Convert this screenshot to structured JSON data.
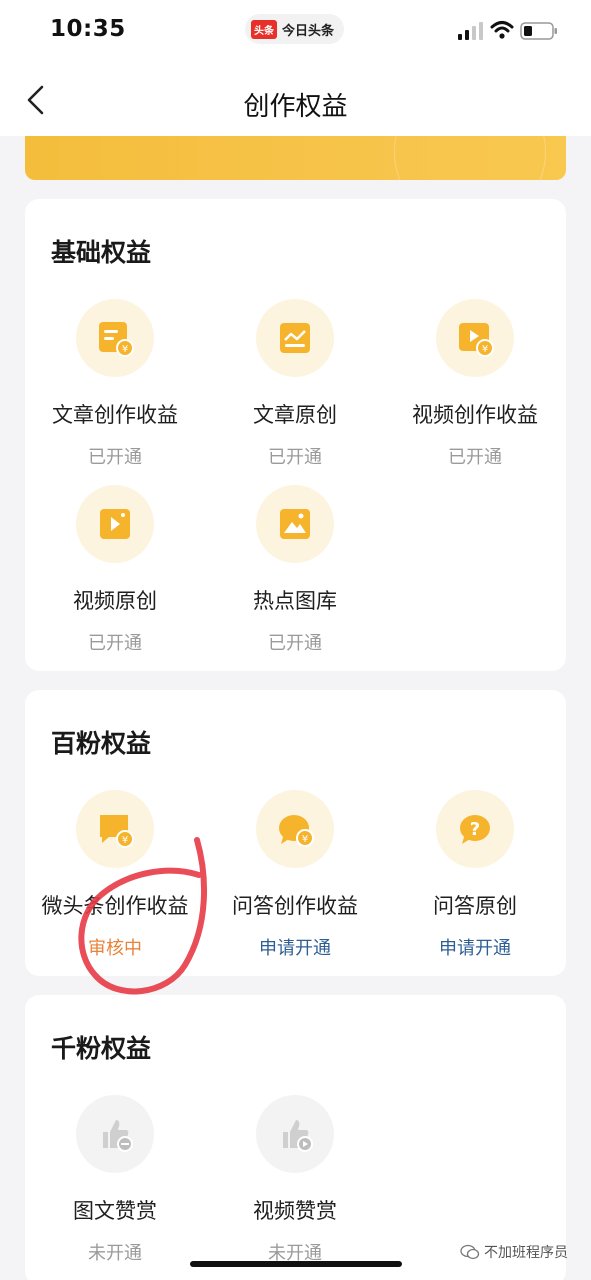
{
  "status_bar": {
    "time": "10:35",
    "app_logo": "头条",
    "app_name": "今日头条"
  },
  "nav": {
    "title": "创作权益"
  },
  "colors": {
    "accent": "#f5b731",
    "icon_bg": "#fdf4df",
    "status_orange": "#e8843a",
    "status_blue": "#2d5e94",
    "annotation_red": "#e63a46"
  },
  "sections": [
    {
      "title": "基础权益",
      "items": [
        {
          "label": "文章创作收益",
          "status": "已开通",
          "icon": "article-income-icon"
        },
        {
          "label": "文章原创",
          "status": "已开通",
          "icon": "article-original-icon"
        },
        {
          "label": "视频创作收益",
          "status": "已开通",
          "icon": "video-income-icon"
        },
        {
          "label": "视频原创",
          "status": "已开通",
          "icon": "video-original-icon"
        },
        {
          "label": "热点图库",
          "status": "已开通",
          "icon": "hot-gallery-icon"
        }
      ]
    },
    {
      "title": "百粉权益",
      "items": [
        {
          "label": "微头条创作收益",
          "status": "审核中",
          "icon": "micro-headline-income-icon"
        },
        {
          "label": "问答创作收益",
          "status": "申请开通",
          "icon": "qa-income-icon"
        },
        {
          "label": "问答原创",
          "status": "申请开通",
          "icon": "qa-original-icon"
        }
      ]
    },
    {
      "title": "千粉权益",
      "items": [
        {
          "label": "图文赞赏",
          "status": "未开通",
          "icon": "article-tip-icon"
        },
        {
          "label": "视频赞赏",
          "status": "未开通",
          "icon": "video-tip-icon"
        }
      ]
    }
  ],
  "watermark": "不加班程序员"
}
